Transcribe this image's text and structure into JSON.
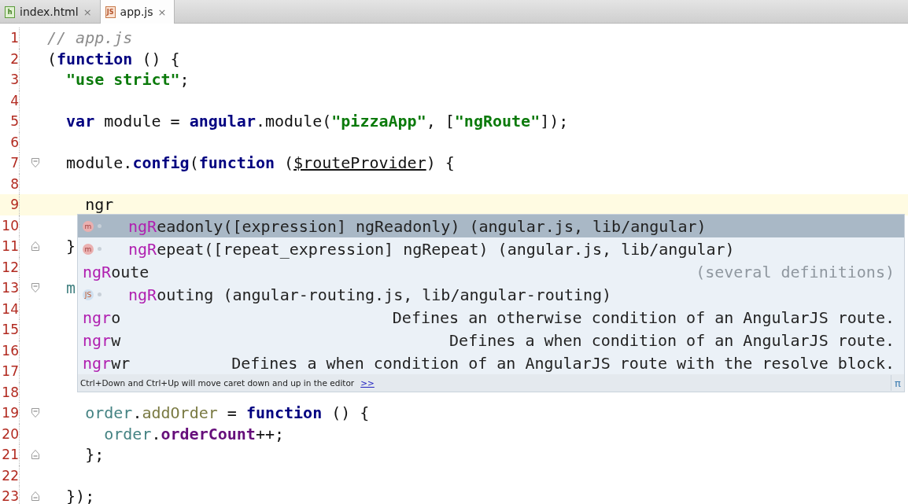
{
  "tabs": [
    {
      "label": "index.html",
      "icon": "h",
      "close": "×",
      "selected": false
    },
    {
      "label": "app.js",
      "icon": "JS",
      "close": "×",
      "selected": true
    }
  ],
  "editor": {
    "lines": [
      {
        "number": "1",
        "kind": "plain",
        "current": false,
        "tokens": [
          {
            "kind": "comment",
            "text": "// app.js"
          }
        ]
      },
      {
        "number": "2",
        "kind": "plain",
        "current": false,
        "tokens": [
          {
            "kind": "plain",
            "text": "("
          },
          {
            "kind": "keyword",
            "text": "function"
          },
          {
            "kind": "plain",
            "text": " () {"
          }
        ]
      },
      {
        "number": "3",
        "kind": "plain",
        "current": false,
        "tokens": [
          {
            "kind": "string",
            "text": "  \"use strict\""
          },
          {
            "kind": "plain",
            "text": ";"
          }
        ]
      },
      {
        "number": "4",
        "kind": "plain",
        "current": false
      },
      {
        "number": "5",
        "kind": "plain",
        "current": false,
        "tokens": [
          {
            "kind": "keyword",
            "text": "  var"
          },
          {
            "kind": "plain",
            "text": " module = "
          },
          {
            "kind": "global",
            "text": "angular"
          },
          {
            "kind": "plain",
            "text": ".module("
          },
          {
            "kind": "string",
            "text": "\"pizzaApp\""
          },
          {
            "kind": "plain",
            "text": ", ["
          },
          {
            "kind": "string",
            "text": "\"ngRoute\""
          },
          {
            "kind": "plain",
            "text": "]);"
          }
        ]
      },
      {
        "number": "6",
        "kind": "plain",
        "current": false
      },
      {
        "number": "7",
        "kind": "start",
        "current": false,
        "tokens": [
          {
            "kind": "plain",
            "text": "  module."
          },
          {
            "kind": "global",
            "text": "config"
          },
          {
            "kind": "plain",
            "text": "("
          },
          {
            "kind": "keyword",
            "text": "function"
          },
          {
            "kind": "plain",
            "text": " ("
          },
          {
            "kind": "param",
            "text": "$routeProvider"
          },
          {
            "kind": "plain",
            "text": ") {"
          }
        ]
      },
      {
        "number": "8",
        "kind": "plain",
        "current": false
      },
      {
        "number": "9",
        "kind": "plain",
        "current": true,
        "tokens": [
          {
            "kind": "plain",
            "text": "    ngr"
          }
        ]
      },
      {
        "number": "10",
        "kind": "plain",
        "current": false
      },
      {
        "number": "11",
        "kind": "end",
        "current": false,
        "tokens": [
          {
            "kind": "plain",
            "text": "  }"
          }
        ]
      },
      {
        "number": "12",
        "kind": "plain",
        "current": false
      },
      {
        "number": "13",
        "kind": "start",
        "current": false,
        "tokens": [
          {
            "kind": "local",
            "text": "  m"
          }
        ]
      },
      {
        "number": "14",
        "kind": "plain",
        "current": false
      },
      {
        "number": "15",
        "kind": "plain",
        "current": false
      },
      {
        "number": "16",
        "kind": "plain",
        "current": false
      },
      {
        "number": "17",
        "kind": "plain",
        "current": false
      },
      {
        "number": "18",
        "kind": "plain",
        "current": false
      },
      {
        "number": "19",
        "kind": "start",
        "current": false,
        "tokens": [
          {
            "kind": "local",
            "text": "    order"
          },
          {
            "kind": "plain",
            "text": "."
          },
          {
            "kind": "method",
            "text": "addOrder"
          },
          {
            "kind": "plain",
            "text": " = "
          },
          {
            "kind": "keyword",
            "text": "function"
          },
          {
            "kind": "plain",
            "text": " () {"
          }
        ]
      },
      {
        "number": "20",
        "kind": "plain",
        "current": false,
        "tokens": [
          {
            "kind": "local",
            "text": "      order"
          },
          {
            "kind": "plain",
            "text": "."
          },
          {
            "kind": "field",
            "text": "orderCount"
          },
          {
            "kind": "plain",
            "text": "++;"
          }
        ]
      },
      {
        "number": "21",
        "kind": "end",
        "current": false,
        "tokens": [
          {
            "kind": "plain",
            "text": "    };"
          }
        ]
      },
      {
        "number": "22",
        "kind": "plain",
        "current": false
      },
      {
        "number": "23",
        "kind": "end",
        "current": false,
        "tokens": [
          {
            "kind": "plain",
            "text": "  });"
          }
        ]
      }
    ]
  },
  "completion": {
    "items": [
      {
        "kind": "method",
        "badge": "m",
        "match": "ngR",
        "rest": "eadonly([expression] ngReadonly) (angular.js, lib/angular)",
        "selected": true
      },
      {
        "kind": "method",
        "badge": "m",
        "match": "ngR",
        "rest": "epeat([repeat_expression] ngRepeat) (angular.js, lib/angular)",
        "selected": false
      },
      {
        "kind": "plain",
        "match": "ngR",
        "rest": "oute",
        "detail": "(several definitions)",
        "detail_muted": true,
        "selected": false
      },
      {
        "kind": "file",
        "badge": "JS",
        "match": "ngR",
        "rest": "outing (angular-routing.js, lib/angular-routing)",
        "selected": false
      },
      {
        "kind": "plain",
        "match": "ngr",
        "rest": "o",
        "detail": "Defines an otherwise condition of an AngularJS route.",
        "detail_muted": false,
        "selected": false
      },
      {
        "kind": "plain",
        "match": "ngr",
        "rest": "w",
        "detail": "Defines a when condition of an AngularJS route.",
        "detail_muted": false,
        "selected": false
      },
      {
        "kind": "plain",
        "match": "ngr",
        "rest": "wr",
        "detail": "Defines a when condition of an AngularJS route with the resolve block.",
        "detail_muted": false,
        "selected": false
      }
    ],
    "hint": "Ctrl+Down and Ctrl+Up will move caret down and up in the editor",
    "hint_link": ">>",
    "pi": "π"
  }
}
